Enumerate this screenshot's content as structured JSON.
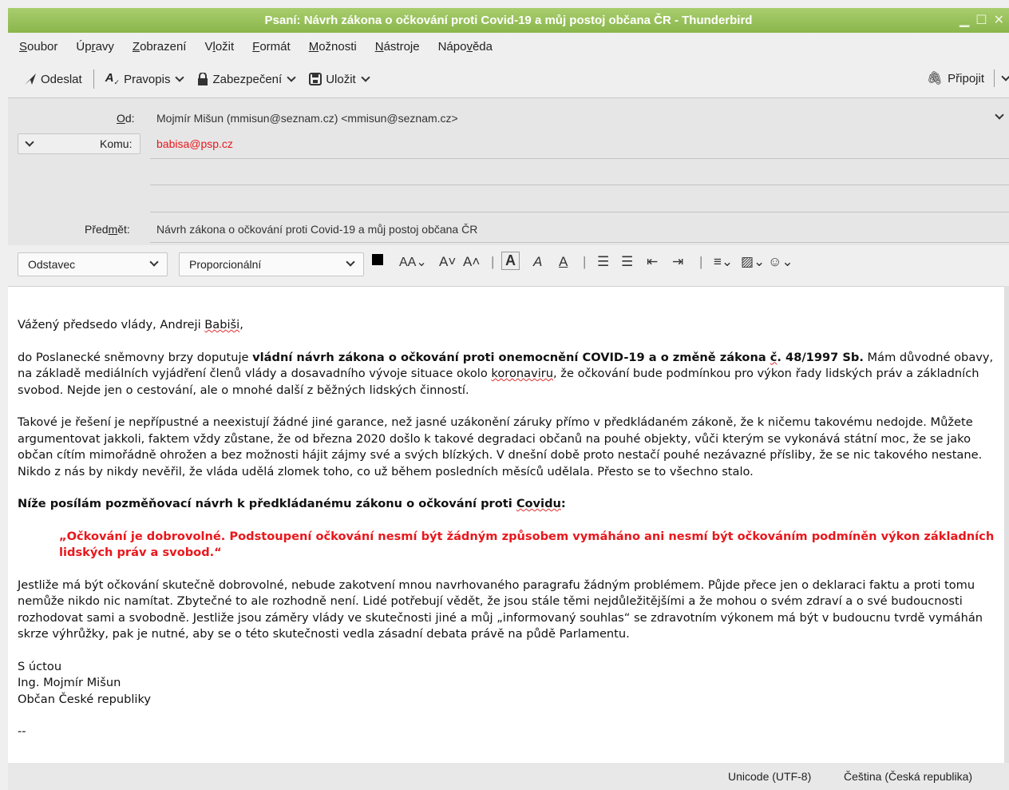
{
  "window": {
    "title": "Psaní: Návrh zákona o očkování proti Covid-19 a můj postoj občana ČR - Thunderbird"
  },
  "menu": [
    {
      "pre": "",
      "u": "S",
      "post": "oubor"
    },
    {
      "pre": "Úp",
      "u": "r",
      "post": "avy"
    },
    {
      "pre": "",
      "u": "Z",
      "post": "obrazení"
    },
    {
      "pre": "V",
      "u": "l",
      "post": "ožit"
    },
    {
      "pre": "",
      "u": "F",
      "post": "ormát"
    },
    {
      "pre": "",
      "u": "M",
      "post": "ožnosti"
    },
    {
      "pre": "",
      "u": "N",
      "post": "ástroje"
    },
    {
      "pre": "Nápo",
      "u": "v",
      "post": "ěda"
    }
  ],
  "toolbar": {
    "send": "Odeslat",
    "spell": "Pravopis",
    "security": "Zabezpečení",
    "save": "Uložit",
    "attach": "Připojit"
  },
  "header": {
    "from_label_u": "O",
    "from_label_rest": "d:",
    "from_value": "Mojmír Mišun (mmisun@seznam.cz) <mmisun@seznam.cz>",
    "to_label": "Komu:",
    "to_value": "babisa@psp.cz",
    "subject_label_pre": "Před",
    "subject_label_u": "m",
    "subject_label_post": "ět:",
    "subject_value": "Návrh zákona o očkování proti Covid-19 a můj postoj občana ČR"
  },
  "format": {
    "paragraph": "Odstavec",
    "font": "Proporcionální"
  },
  "message": {
    "greeting_pre": "Vážený předsedo vlády, Andreji ",
    "greeting_name": "Babiši",
    "greeting_post": ",",
    "p1_pre": "do Poslanecké sněmovny brzy doputuje ",
    "p1_bold_a": "vládní návrh zákona o očkování proti onemocnění COVID-19 a o změně zákona ",
    "p1_bold_c": "č",
    "p1_bold_b": ". 48/1997 Sb.",
    "p1_mid": " Mám důvodné obavy, na základě mediálních vyjádření členů vlády a dosavadního vývoje situace okolo ",
    "p1_kor": "koronaviru",
    "p1_post": ", že očkování bude podmínkou pro výkon řady lidských práv a základních svobod. Nejde jen o cestování, ale o mnohé další z běžných lidských činností.",
    "p2": "Takové je řešení je nepřípustné a neexistují žádné jiné garance, než jasné uzákonění záruky přímo v předkládaném zákoně, že k ničemu takovému nedojde. Můžete argumentovat jakkoli, faktem vždy zůstane, že od března 2020 došlo k takové degradaci občanů na pouhé objekty, vůči kterým se vykonává státní moc, že se jako občan cítím mimořádně ohrožen a bez možnosti hájit zájmy své a svých blízkých. V dnešní době proto nestačí pouhé nezávazné přísliby, že se nic takového nestane. Nikdo z nás by nikdy nevěřil, že vláda udělá zlomek toho, co už během posledních měsíců udělala. Přesto se to všechno stalo.",
    "heading_pre": "Níže posílám pozměňovací návrh k předkládanému zákonu o očkování proti ",
    "heading_cov": "Covidu",
    "heading_post": ":",
    "quote": "„Očkování je dobrovolné. Podstoupení očkování nesmí být žádným způsobem vymáháno ani nesmí být očkováním podmíněn výkon základních lidských práv a svobod.“",
    "p3": "Jestliže má být očkování skutečně dobrovolné, nebude zakotvení mnou navrhovaného paragrafu žádným problémem. Půjde přece jen o deklaraci faktu a proti tomu nemůže nikdo nic namítat. Zbytečné to ale rozhodně není. Lidé potřebují vědět, že jsou stále těmi nejdůležitějšími a že mohou o svém zdraví a o své budoucnosti rozhodovat sami a svobodně. Jestliže jsou záměry vlády ve skutečnosti jiné a můj „informovaný souhlas“ se zdravotním výkonem má být v budoucnu tvrdě vymáhán skrze výhrůžky, pak je nutné, aby se o této skutečnosti vedla zásadní debata právě na půdě Parlamentu.",
    "sign1": "S úctou",
    "sign2": "Ing. Mojmír Mišun",
    "sign3": "Občan České republiky",
    "sigsep": "--"
  },
  "status": {
    "encoding": "Unicode (UTF-8)",
    "language": "Čeština (Česká republika)"
  },
  "colors": {
    "titlebar": "#8ab64b",
    "recipient": "#e8171c",
    "quote": "#e8171c"
  }
}
